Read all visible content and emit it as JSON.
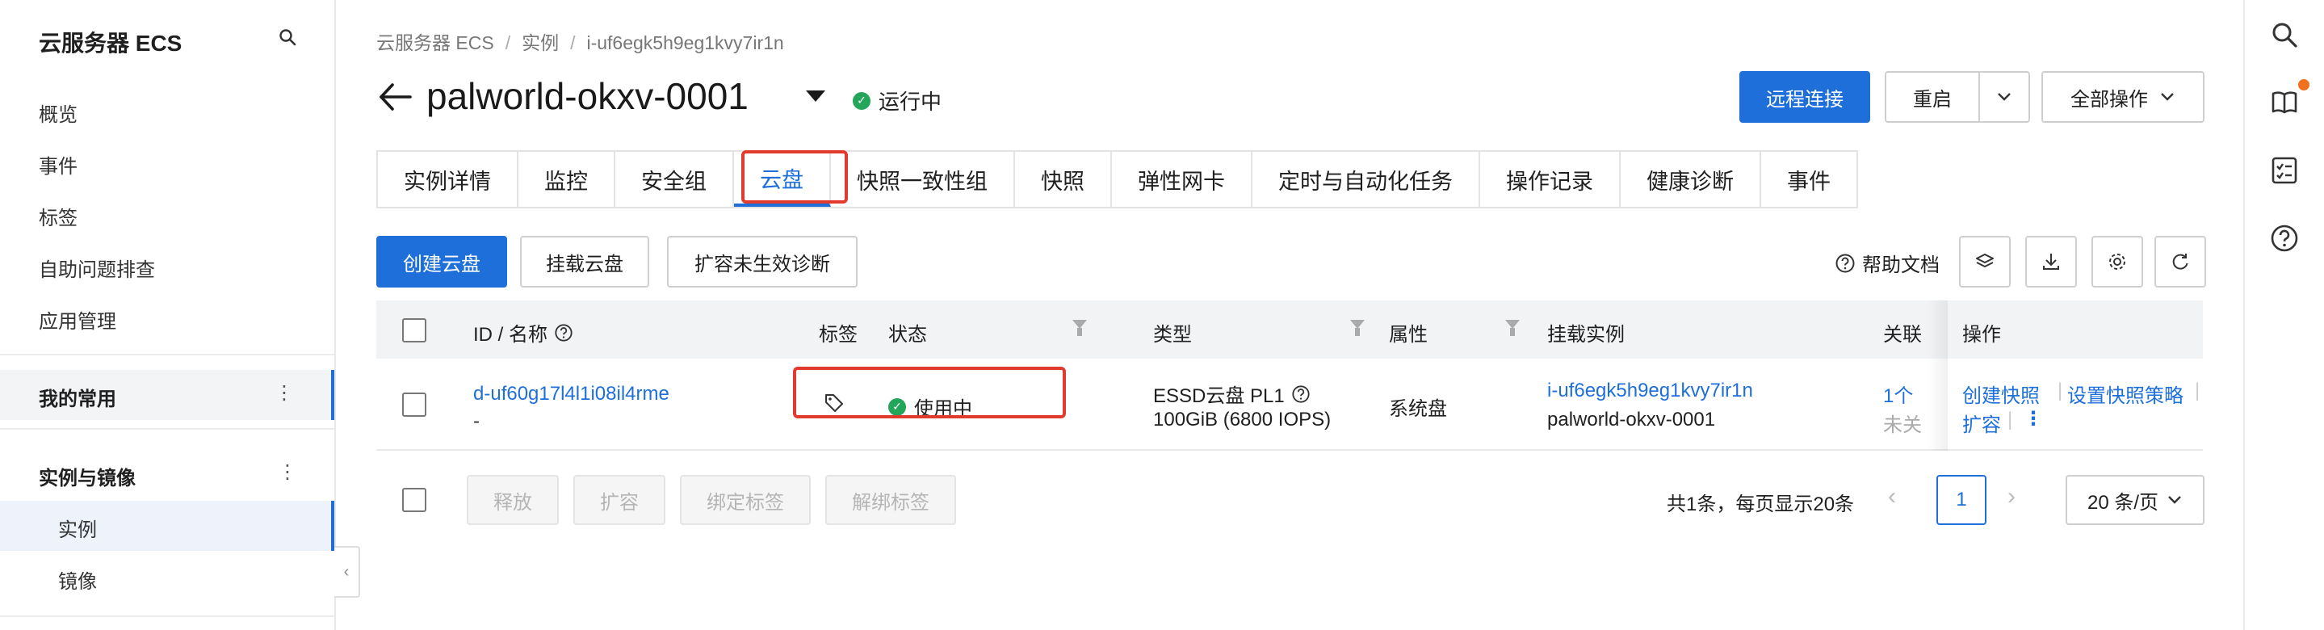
{
  "sidebar": {
    "title": "云服务器 ECS",
    "items": [
      "概览",
      "事件",
      "标签",
      "自助问题排查",
      "应用管理"
    ],
    "group_favorites": "我的常用",
    "group_instances": "实例与镜像",
    "sub_items": [
      "实例",
      "镜像"
    ],
    "dots": "⋮",
    "collapse_glyph": "‹"
  },
  "breadcrumb": [
    "云服务器 ECS",
    "实例",
    "i-uf6egk5h9eg1kvy7ir1n"
  ],
  "breadcrumb_sep": "/",
  "header": {
    "instance_name": "palworld-okxv-0001",
    "status": "运行中",
    "btn_remote": "远程连接",
    "btn_restart": "重启",
    "btn_all_ops": "全部操作"
  },
  "tabs": [
    "实例详情",
    "监控",
    "安全组",
    "云盘",
    "快照一致性组",
    "快照",
    "弹性网卡",
    "定时与自动化任务",
    "操作记录",
    "健康诊断",
    "事件"
  ],
  "active_tab": "云盘",
  "toolbar": {
    "create_disk": "创建云盘",
    "attach_disk": "挂载云盘",
    "diagnose": "扩容未生效诊断",
    "help_doc": "帮助文档"
  },
  "table": {
    "headers": {
      "id_name": "ID / 名称",
      "tags": "标签",
      "status": "状态",
      "type": "类型",
      "attribute": "属性",
      "attached_instance": "挂载实例",
      "related": "关联",
      "actions": "操作"
    },
    "rows": [
      {
        "id": "d-uf60g17l4l1i08il4rme",
        "name": "-",
        "status": "使用中",
        "type_line1": "ESSD云盘 PL1",
        "type_line2": "100GiB (6800 IOPS)",
        "attribute": "系统盘",
        "instance_id": "i-uf6egk5h9eg1kvy7ir1n",
        "instance_name": "palworld-okxv-0001",
        "related_line1": "1个",
        "related_line2": "未关",
        "action_snapshot": "创建快照",
        "action_policy": "设置快照策略",
        "action_expand": "扩容"
      }
    ]
  },
  "bulk": {
    "release": "释放",
    "expand": "扩容",
    "bind_tag": "绑定标签",
    "unbind_tag": "解绑标签"
  },
  "pagination": {
    "summary": "共1条，每页显示20条",
    "current_page": "1",
    "page_size": "20 条/页",
    "prev": "‹",
    "next": "›"
  },
  "colors": {
    "primary": "#1e6fd9",
    "running": "#23a55a",
    "highlight": "#e23b2e"
  }
}
